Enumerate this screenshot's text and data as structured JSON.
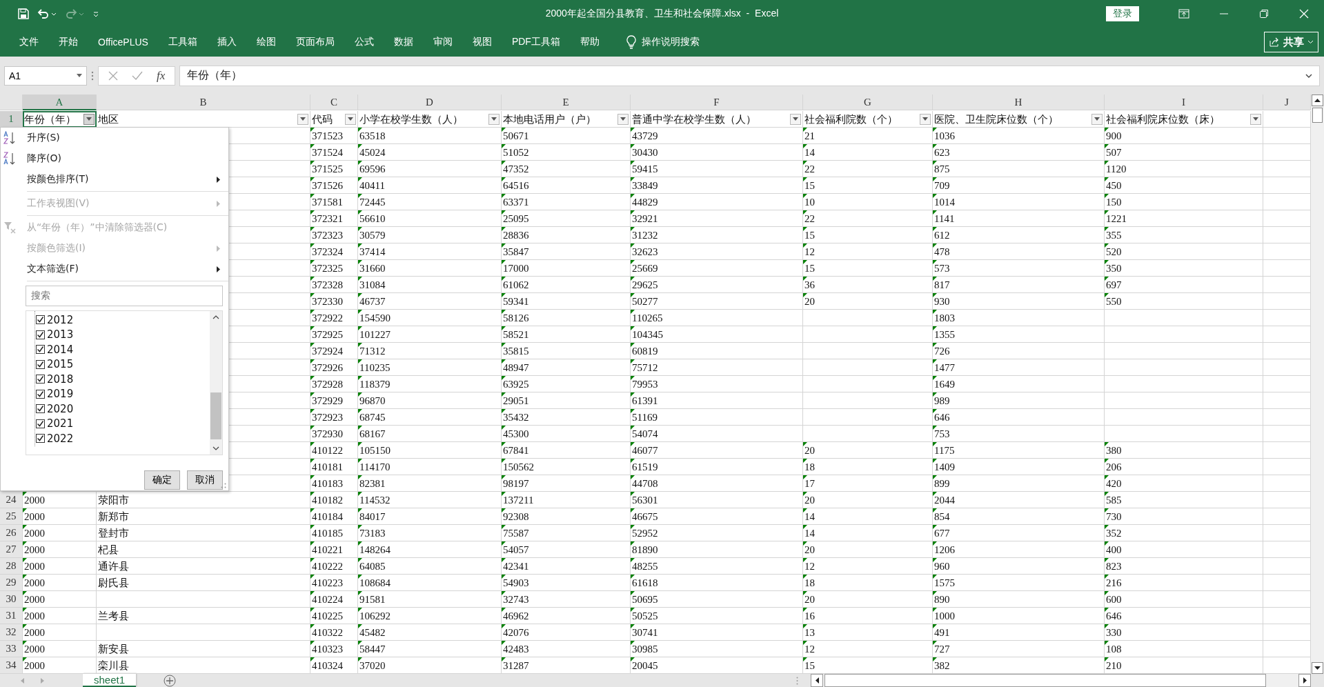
{
  "window": {
    "title": "2000年起全国分县教育、卫生和社会保障.xlsx  -  Excel",
    "login": "登录"
  },
  "ribbon": {
    "tabs": [
      {
        "label": "文件"
      },
      {
        "label": "开始"
      },
      {
        "label": "OfficePLUS"
      },
      {
        "label": "工具箱"
      },
      {
        "label": "插入"
      },
      {
        "label": "绘图"
      },
      {
        "label": "页面布局"
      },
      {
        "label": "公式"
      },
      {
        "label": "数据"
      },
      {
        "label": "审阅"
      },
      {
        "label": "视图"
      },
      {
        "label": "PDF工具箱"
      },
      {
        "label": "帮助"
      }
    ],
    "tell_me": "操作说明搜索",
    "share": "共享"
  },
  "formula_bar": {
    "name_box": "A1",
    "function_label": "fx",
    "value": "年份（年）"
  },
  "table": {
    "header_row": {
      "number": "1",
      "selected": true
    },
    "columns": [
      {
        "letter": "A",
        "header": "年份（年）",
        "selected": true,
        "filter_open": true,
        "text_numbers": true
      },
      {
        "letter": "B",
        "header": "地区",
        "selected": false,
        "filter_open": false,
        "text_numbers": false
      },
      {
        "letter": "C",
        "header": "代码",
        "selected": false,
        "filter_open": false,
        "text_numbers": true
      },
      {
        "letter": "D",
        "header": "小学在校学生数（人）",
        "selected": false,
        "filter_open": false,
        "text_numbers": true
      },
      {
        "letter": "E",
        "header": "本地电话用户（户）",
        "selected": false,
        "filter_open": false,
        "text_numbers": true
      },
      {
        "letter": "F",
        "header": "普通中学在校学生数（人）",
        "selected": false,
        "filter_open": false,
        "text_numbers": true
      },
      {
        "letter": "G",
        "header": "社会福利院数（个）",
        "selected": false,
        "filter_open": false,
        "text_numbers": true
      },
      {
        "letter": "H",
        "header": "医院、卫生院床位数（个）",
        "selected": false,
        "filter_open": false,
        "text_numbers": true
      },
      {
        "letter": "I",
        "header": "社会福利院床位数（床）",
        "selected": false,
        "filter_open": false,
        "text_numbers": true
      },
      {
        "letter": "J"
      }
    ],
    "rows": [
      {
        "cells": {
          "C": "371523",
          "D": "63518",
          "E": "50671",
          "F": "43729",
          "G": "21",
          "H": "1036",
          "I": "900"
        }
      },
      {
        "cells": {
          "C": "371524",
          "D": "45024",
          "E": "51052",
          "F": "30430",
          "G": "14",
          "H": "623",
          "I": "507"
        }
      },
      {
        "cells": {
          "C": "371525",
          "D": "69596",
          "E": "47352",
          "F": "59415",
          "G": "22",
          "H": "875",
          "I": "1120"
        }
      },
      {
        "cells": {
          "C": "371526",
          "D": "40411",
          "E": "64516",
          "F": "33849",
          "G": "15",
          "H": "709",
          "I": "450"
        }
      },
      {
        "cells": {
          "C": "371581",
          "D": "72445",
          "E": "63371",
          "F": "44829",
          "G": "10",
          "H": "1014",
          "I": "150"
        }
      },
      {
        "cells": {
          "C": "372321",
          "D": "56610",
          "E": "25095",
          "F": "32921",
          "G": "22",
          "H": "1141",
          "I": "1221"
        }
      },
      {
        "cells": {
          "C": "372323",
          "D": "30579",
          "E": "28836",
          "F": "31232",
          "G": "15",
          "H": "612",
          "I": "355"
        }
      },
      {
        "cells": {
          "C": "372324",
          "D": "37414",
          "E": "35847",
          "F": "32623",
          "G": "12",
          "H": "478",
          "I": "520"
        }
      },
      {
        "cells": {
          "C": "372325",
          "D": "31660",
          "E": "17000",
          "F": "25669",
          "G": "15",
          "H": "573",
          "I": "350"
        }
      },
      {
        "cells": {
          "C": "372328",
          "D": "31084",
          "E": "61062",
          "F": "29625",
          "G": "36",
          "H": "817",
          "I": "697"
        }
      },
      {
        "cells": {
          "C": "372330",
          "D": "46737",
          "E": "59341",
          "F": "50277",
          "G": "20",
          "H": "930",
          "I": "550"
        }
      },
      {
        "cells": {
          "C": "372922",
          "D": "154590",
          "E": "58126",
          "F": "110265",
          "H": "1803"
        }
      },
      {
        "cells": {
          "C": "372925",
          "D": "101227",
          "E": "58521",
          "F": "104345",
          "H": "1355"
        }
      },
      {
        "cells": {
          "C": "372924",
          "D": "71312",
          "E": "35815",
          "F": "60819",
          "H": "726"
        }
      },
      {
        "cells": {
          "C": "372926",
          "D": "110235",
          "E": "48947",
          "F": "75712",
          "H": "1477"
        }
      },
      {
        "cells": {
          "C": "372928",
          "D": "118379",
          "E": "63925",
          "F": "79953",
          "H": "1649"
        }
      },
      {
        "cells": {
          "C": "372929",
          "D": "96870",
          "E": "29051",
          "F": "61391",
          "H": "989"
        }
      },
      {
        "cells": {
          "C": "372923",
          "D": "68745",
          "E": "35432",
          "F": "51169",
          "H": "646"
        }
      },
      {
        "cells": {
          "C": "372930",
          "D": "68167",
          "E": "45300",
          "F": "54074",
          "H": "753"
        }
      },
      {
        "cells": {
          "C": "410122",
          "D": "105150",
          "E": "67841",
          "F": "46077",
          "G": "20",
          "H": "1175",
          "I": "380"
        }
      },
      {
        "cells": {
          "C": "410181",
          "D": "114170",
          "E": "150562",
          "F": "61519",
          "G": "18",
          "H": "1409",
          "I": "206"
        }
      },
      {
        "cells": {
          "C": "410183",
          "D": "82381",
          "E": "98197",
          "F": "44708",
          "G": "17",
          "H": "899",
          "I": "420"
        }
      },
      {
        "number": "24",
        "cells": {
          "A": "2000",
          "B": "荥阳市",
          "C": "410182",
          "D": "114532",
          "E": "137211",
          "F": "56301",
          "G": "20",
          "H": "2044",
          "I": "585"
        }
      },
      {
        "number": "25",
        "cells": {
          "A": "2000",
          "B": "新郑市",
          "C": "410184",
          "D": "84017",
          "E": "92308",
          "F": "46675",
          "G": "14",
          "H": "854",
          "I": "730"
        }
      },
      {
        "number": "26",
        "cells": {
          "A": "2000",
          "B": "登封市",
          "C": "410185",
          "D": "73183",
          "E": "75587",
          "F": "52952",
          "G": "14",
          "H": "677",
          "I": "352"
        }
      },
      {
        "number": "27",
        "cells": {
          "A": "2000",
          "B": "杞县",
          "C": "410221",
          "D": "148264",
          "E": "54057",
          "F": "81890",
          "G": "20",
          "H": "1206",
          "I": "400"
        }
      },
      {
        "number": "28",
        "cells": {
          "A": "2000",
          "B": "通许县",
          "C": "410222",
          "D": "64085",
          "E": "42341",
          "F": "48255",
          "G": "12",
          "H": "960",
          "I": "823"
        }
      },
      {
        "number": "29",
        "cells": {
          "A": "2000",
          "B": "尉氏县",
          "C": "410223",
          "D": "108684",
          "E": "54903",
          "F": "61618",
          "G": "18",
          "H": "1575",
          "I": "216"
        }
      },
      {
        "number": "30",
        "cells": {
          "A": "2000",
          "C": "410224",
          "D": "91581",
          "E": "32743",
          "F": "50695",
          "G": "20",
          "H": "890",
          "I": "600"
        }
      },
      {
        "number": "31",
        "cells": {
          "A": "2000",
          "B": "兰考县",
          "C": "410225",
          "D": "106292",
          "E": "46962",
          "F": "50525",
          "G": "16",
          "H": "1000",
          "I": "646"
        }
      },
      {
        "number": "32",
        "cells": {
          "A": "2000",
          "C": "410322",
          "D": "45482",
          "E": "42076",
          "F": "30741",
          "G": "13",
          "H": "491",
          "I": "330"
        }
      },
      {
        "number": "33",
        "cells": {
          "A": "2000",
          "B": "新安县",
          "C": "410323",
          "D": "58447",
          "E": "42483",
          "F": "30985",
          "G": "12",
          "H": "727",
          "I": "108"
        }
      },
      {
        "number": "34",
        "cells": {
          "A": "2000",
          "B": "栾川县",
          "C": "410324",
          "D": "37020",
          "E": "31287",
          "F": "20045",
          "G": "15",
          "H": "382",
          "I": "210"
        }
      }
    ]
  },
  "filter_menu": {
    "items": [
      {
        "kind": "sort-ascending",
        "label": "升序(S)",
        "disabled": false,
        "submenu": false
      },
      {
        "kind": "sort-descending",
        "label": "降序(O)",
        "disabled": false,
        "submenu": false
      },
      {
        "kind": "command",
        "label": "按颜色排序(T)",
        "disabled": false,
        "submenu": true
      },
      {
        "kind": "separator"
      },
      {
        "kind": "command",
        "label": "工作表视图(V)",
        "disabled": true,
        "submenu": true
      },
      {
        "kind": "separator"
      },
      {
        "kind": "clear-filter",
        "label": "从“年份（年）”中清除筛选器(C)",
        "disabled": true,
        "submenu": false
      },
      {
        "kind": "command",
        "label": "按颜色筛选(I)",
        "disabled": true,
        "submenu": true
      },
      {
        "kind": "command",
        "label": "文本筛选(F)",
        "disabled": false,
        "submenu": true
      },
      {
        "kind": "separator"
      }
    ],
    "search": {
      "placeholder": "搜索"
    },
    "values": [
      {
        "label": "2012",
        "checked": true
      },
      {
        "label": "2013",
        "checked": true
      },
      {
        "label": "2014",
        "checked": true
      },
      {
        "label": "2015",
        "checked": true
      },
      {
        "label": "2018",
        "checked": true
      },
      {
        "label": "2019",
        "checked": true
      },
      {
        "label": "2020",
        "checked": true
      },
      {
        "label": "2021",
        "checked": true
      },
      {
        "label": "2022",
        "checked": true
      }
    ],
    "buttons": [
      "确定",
      "取消"
    ]
  },
  "sheet_tabs": [
    {
      "label": "sheet1",
      "selected": true
    }
  ]
}
